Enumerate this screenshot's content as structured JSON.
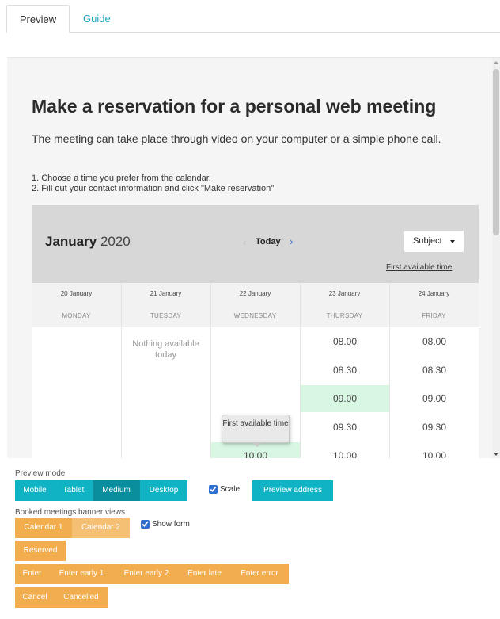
{
  "tabs": [
    {
      "label": "Preview"
    },
    {
      "label": "Guide"
    }
  ],
  "preview": {
    "title": "Make a reservation for a personal web meeting",
    "intro": "The meeting can take place through video on your computer or a simple phone call.",
    "steps": [
      "1. Choose a time you prefer from the calendar.",
      "2. Fill out your contact information and click \"Make reservation\""
    ],
    "calendar": {
      "month": "January",
      "year": "2020",
      "prev_icon": "chevron-left-icon",
      "today_label": "Today",
      "next_icon": "chevron-right-icon",
      "subject_label": "Subject",
      "first_available_label": "First available time",
      "columns": [
        {
          "date": "20 January",
          "day": "MONDAY"
        },
        {
          "date": "21 January",
          "day": "TUESDAY"
        },
        {
          "date": "22 January",
          "day": "WEDNESDAY"
        },
        {
          "date": "23 January",
          "day": "THURSDAY"
        },
        {
          "date": "24 January",
          "day": "FRIDAY"
        }
      ],
      "nothing_available": "Nothing available today",
      "slots_thursday": [
        "08.00",
        "08.30",
        "09.00",
        "09.30",
        "10.00"
      ],
      "slots_friday": [
        "08.00",
        "08.30",
        "09.00",
        "09.30",
        "10.00"
      ],
      "slot_wednesday": "10.00",
      "highlight_color": "#d8f7e2",
      "tooltip": "First available time"
    }
  },
  "controls": {
    "preview_mode_label": "Preview mode",
    "modes": [
      "Mobile",
      "Tablet",
      "Medium",
      "Desktop"
    ],
    "selected_mode": "Medium",
    "scale_label": "Scale",
    "scale_checked": true,
    "preview_address_label": "Preview address",
    "banner_views_label": "Booked meetings banner views",
    "calendars": [
      "Calendar 1",
      "Calendar 2"
    ],
    "show_form_label": "Show form",
    "show_form_checked": true,
    "reserved_label": "Reserved",
    "enter_buttons": [
      "Enter",
      "Enter early 1",
      "Enter early 2",
      "Enter late",
      "Enter error"
    ],
    "cancel_buttons": [
      "Cancel",
      "Cancelled"
    ]
  },
  "colors": {
    "teal": "#10b3c4",
    "teal_selected": "#0a8d9c",
    "orange": "#f2ad4e",
    "tab_link": "#1ea7c2"
  }
}
